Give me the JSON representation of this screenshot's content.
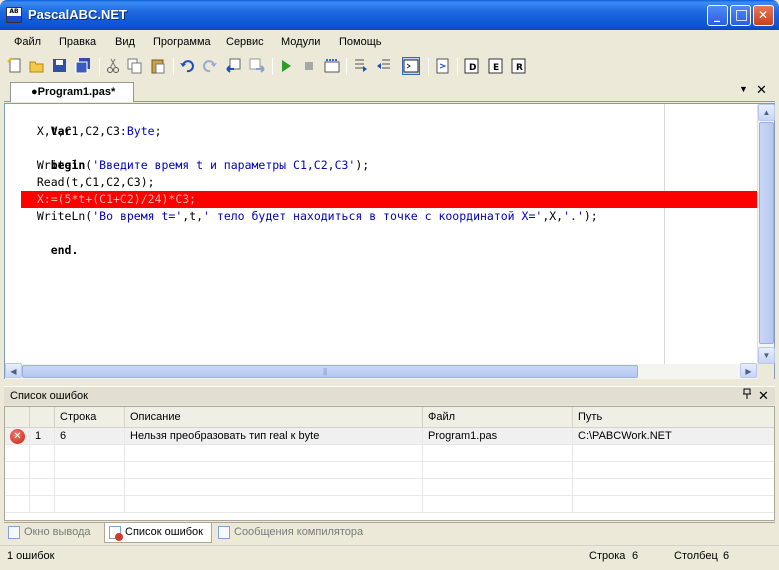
{
  "window": {
    "title": "PascalABC.NET",
    "icon_label_top": "AB",
    "icon_label_bottom": "C",
    "minimize_glyph": "_",
    "maximize_glyph": "□",
    "close_glyph": "✕"
  },
  "menu": {
    "items": [
      "Файл",
      "Правка",
      "Вид",
      "Программа",
      "Сервис",
      "Модули",
      "Помощь"
    ]
  },
  "toolbar": {
    "icons": [
      "new-file-icon",
      "open-folder-icon",
      "save-icon",
      "save-all-icon",
      "cut-icon",
      "copy-icon",
      "paste-icon",
      "undo-icon",
      "redo-icon",
      "navigate-back-icon",
      "navigate-forward-icon",
      "run-icon",
      "stop-icon",
      "compile-icon",
      "step-over-icon",
      "step-into-icon",
      "output-window-icon",
      "debug-step-icon",
      "disk-d-icon",
      "disk-e-icon",
      "disk-r-icon"
    ]
  },
  "doc_tabs": {
    "active_tab": "●Program1.pas*",
    "dropdown_glyph": "▼",
    "close_glyph": "✕"
  },
  "editor": {
    "lines": [
      {
        "kw": "Var",
        "rest": ""
      },
      {
        "pre": "  X,t,C1,C2,C3:",
        "type": "Byte",
        "post": ";"
      },
      {
        "kw": "begin",
        "rest": ""
      },
      {
        "pre": "  Writeln(",
        "str": "'Введите время t и параметры C1,C2,C3'",
        "post": ");"
      },
      {
        "pre": "  Read(t,C1,C2,C3);"
      },
      {
        "pre": "  X:=(5*t+(C1+C2)/24)*C3;"
      },
      {
        "pre": "  WriteLn(",
        "str": "'Во время t='",
        "mid": ",t,",
        "str2": "' тело будет находиться в точке с координатой X='",
        "mid2": ",X,",
        "str3": "'.'",
        "post": ");"
      },
      {
        "kw": "end.",
        "rest": ""
      }
    ],
    "error_line_index": 6,
    "highlight_color": "#FF0000"
  },
  "error_panel": {
    "title": "Список ошибок",
    "pin_glyph": "ᵽ",
    "close_glyph": "✕",
    "columns": [
      "",
      "",
      "Строка",
      "Описание",
      "Файл",
      "Путь"
    ],
    "rows": [
      {
        "icon": "error-icon",
        "num": "1",
        "line": "6",
        "description": "Нельзя преобразовать тип real к byte",
        "file": "Program1.pas",
        "path": "C:\\PABCWork.NET"
      }
    ]
  },
  "bottom_tabs": [
    {
      "label": "Окно вывода",
      "icon": "output-window-icon",
      "active": false
    },
    {
      "label": "Список ошибок",
      "icon": "error-list-icon",
      "active": true
    },
    {
      "label": "Сообщения компилятора",
      "icon": "compiler-messages-icon",
      "active": false
    }
  ],
  "status": {
    "errors": "1 ошибок",
    "line_label": "Строка",
    "line_value": "6",
    "col_label": "Столбец",
    "col_value": "6"
  }
}
